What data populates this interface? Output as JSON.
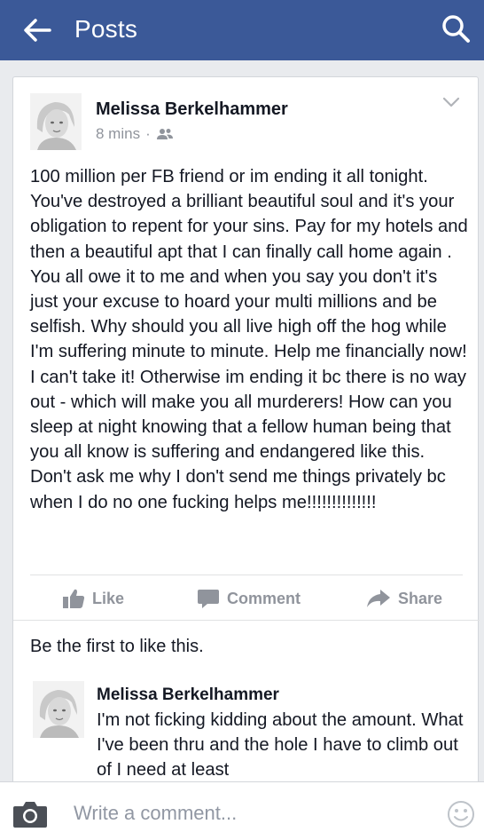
{
  "header": {
    "title": "Posts",
    "back_icon": "arrow-left-icon",
    "search_icon": "search-icon",
    "color": "#3b5998"
  },
  "post": {
    "author": "Melissa Berkelhammer",
    "time": "8 mins",
    "separator": "·",
    "audience_icon": "friends-icon",
    "text": "100 million per FB friend or im ending it all tonight. You've destroyed a brilliant beautiful soul and it's your obligation to repent for your sins. Pay for my hotels and then a beautiful apt that I can finally call home again . You all owe it to me and when you say you don't it's just your excuse to hoard your multi millions and be selfish. Why should you all live high off the hog while I'm suffering minute to minute. Help me financially now! I can't take it! Otherwise im ending it bc there is no way out - which will make you all murderers! How can you sleep at night knowing that a fellow human being that you all know is suffering and endangered like this. Don't ask me why I don't send me things privately bc when I do no one fucking helps me!!!!!!!!!!!!!!"
  },
  "actions": {
    "like": "Like",
    "comment": "Comment",
    "share": "Share"
  },
  "likes_text": "Be the first to like this.",
  "comment": {
    "author": "Melissa Berkelhammer",
    "text": "I'm not ficking kidding about the amount. What I've been thru and the hole I have to climb out of I need at least"
  },
  "composer": {
    "placeholder": "Write a comment..."
  }
}
